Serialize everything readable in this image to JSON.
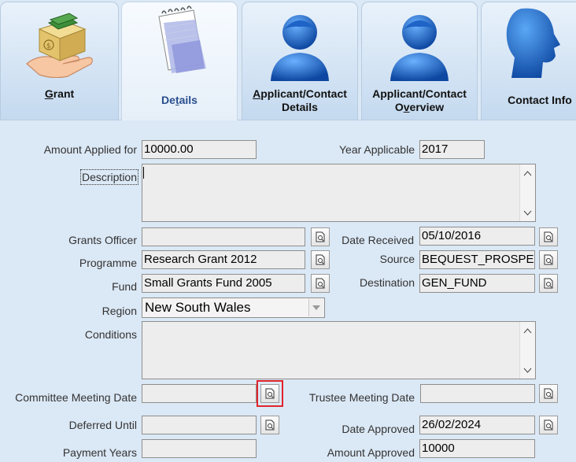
{
  "tabs": [
    {
      "id": "grant",
      "label_pre": "",
      "label_ul": "G",
      "label_post": "rant",
      "icon": "grant-box-icon"
    },
    {
      "id": "details",
      "label_pre": "De",
      "label_ul": "t",
      "label_post": "ails",
      "icon": "notepad-icon"
    },
    {
      "id": "applicant-details",
      "line1_pre": "",
      "line1_ul": "A",
      "line1_post": "pplicant/Contact",
      "line2": "Details",
      "icon": "person-icon"
    },
    {
      "id": "applicant-overview",
      "line1": "Applicant/Contact",
      "line2_pre": "O",
      "line2_ul": "v",
      "line2_post": "erview",
      "icon": "person-icon"
    },
    {
      "id": "contact-info",
      "label": "Contact Info",
      "icon": "head-profile-icon"
    }
  ],
  "form": {
    "amount_applied_label": "Amount Applied for",
    "amount_applied_value": "10000.00",
    "year_applicable_label": "Year Applicable",
    "year_applicable_value": "2017",
    "description_label": "Description",
    "description_value": "",
    "grants_officer_label": "Grants Officer",
    "grants_officer_value": "",
    "date_received_label": "Date Received",
    "date_received_value": "05/10/2016",
    "programme_label": "Programme",
    "programme_value": "Research Grant 2012",
    "source_label": "Source",
    "source_value": "BEQUEST_PROSPECT",
    "fund_label": "Fund",
    "fund_value": "Small Grants Fund 2005",
    "destination_label": "Destination",
    "destination_value": "GEN_FUND",
    "region_label": "Region",
    "region_value": "New South Wales",
    "conditions_label": "Conditions",
    "conditions_value": "",
    "committee_meeting_label": "Committee Meeting Date",
    "committee_meeting_value": "",
    "trustee_meeting_label": "Trustee Meeting Date",
    "trustee_meeting_value": "",
    "deferred_until_label": "Deferred Until",
    "deferred_until_value": "",
    "date_approved_label": "Date Approved",
    "date_approved_value": "26/02/2024",
    "payment_years_label": "Payment Years",
    "payment_years_value": "",
    "amount_approved_label": "Amount Approved",
    "amount_approved_value": "10000"
  },
  "colors": {
    "background": "#dbe8f5",
    "field_bg": "#ededed",
    "active_tab_text": "#2a4f8e",
    "highlight": "#e0242b",
    "person_icon": "#1565c0"
  }
}
